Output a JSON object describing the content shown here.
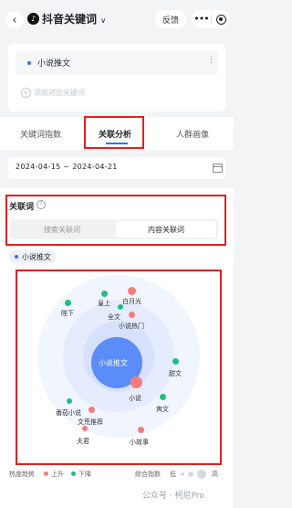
{
  "header": {
    "back_icon": "chevron-left-icon",
    "app_icon": "tiktok-logo-icon",
    "title": "抖音关键词",
    "title_caret": "∨",
    "feedback_label": "反馈",
    "more_label": "•••"
  },
  "keyword_card": {
    "keyword": "小说推文",
    "more_label": "⋮",
    "add_label": "添加对比关键词"
  },
  "tabs": [
    {
      "label": "关键词指数"
    },
    {
      "label": "关联分析"
    },
    {
      "label": "人群画像"
    }
  ],
  "date_range": {
    "start": "2024-04-15",
    "separator": "~",
    "end": "2024-04-21"
  },
  "related_section": {
    "title": "关联词",
    "help": "?",
    "segments": {
      "search": "搜索关联词",
      "content": "内容关联词"
    },
    "chip": "小说推文"
  },
  "bubbles": {
    "center": "小说推文",
    "items": [
      {
        "label": "皇上",
        "color": "#1fbf7f"
      },
      {
        "label": "白月光",
        "color": "#f47c7c"
      },
      {
        "label": "陛下",
        "color": "#1fbf7f"
      },
      {
        "label": "全文",
        "color": "#1fbf7f"
      },
      {
        "label": "小说热门",
        "color": "#f47c7c"
      },
      {
        "label": "甜文",
        "color": "#1fbf7f"
      },
      {
        "label": "小说",
        "color": "#f47c7c"
      },
      {
        "label": "爽文",
        "color": "#1fbf7f"
      },
      {
        "label": "番茄小说",
        "color": "#1fbf7f"
      },
      {
        "label": "文荒推荐",
        "color": "#f47c7c"
      },
      {
        "label": "夫君",
        "color": "#f47c7c"
      },
      {
        "label": "小故事",
        "color": "#f47c7c"
      }
    ]
  },
  "legend": {
    "trend_label": "热度趋势",
    "up_label": "上升",
    "down_label": "下降",
    "up_color": "#f47c7c",
    "down_color": "#1fbf7f",
    "index_label": "综合指数",
    "low_label": "低",
    "high_label": "高"
  },
  "watermark": "公众号 · 柯尼Pro"
}
